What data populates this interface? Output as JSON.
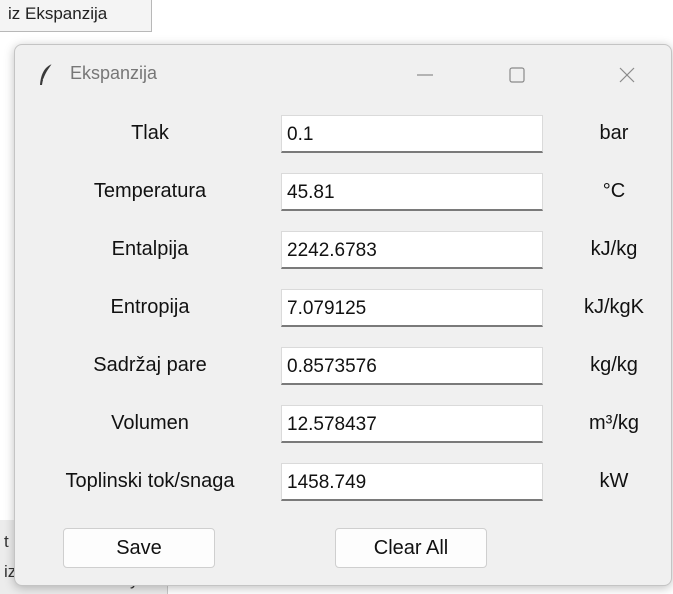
{
  "background": {
    "button_label": "iz Ekspanzija",
    "fragment_a": "t",
    "fragment_b": "iz",
    "fragment_c": "y"
  },
  "window": {
    "title": "Ekspanzija",
    "icon": "feather-icon",
    "controls": {
      "minimize": "minimize-icon",
      "maximize": "maximize-icon",
      "close": "close-icon"
    }
  },
  "form": {
    "rows": [
      {
        "label": "Tlak",
        "value": "0.1",
        "unit": "bar"
      },
      {
        "label": "Temperatura",
        "value": "45.81",
        "unit": "°C"
      },
      {
        "label": "Entalpija",
        "value": "2242.6783",
        "unit": "kJ/kg"
      },
      {
        "label": "Entropija",
        "value": "7.079125",
        "unit": "kJ/kgK"
      },
      {
        "label": "Sadržaj pare",
        "value": "0.8573576",
        "unit": "kg/kg"
      },
      {
        "label": "Volumen",
        "value": "12.578437",
        "unit": "m³/kg"
      },
      {
        "label": "Toplinski tok/snaga",
        "value": "1458.749",
        "unit": "kW"
      }
    ]
  },
  "buttons": {
    "save_label": "Save",
    "clear_label": "Clear All"
  }
}
